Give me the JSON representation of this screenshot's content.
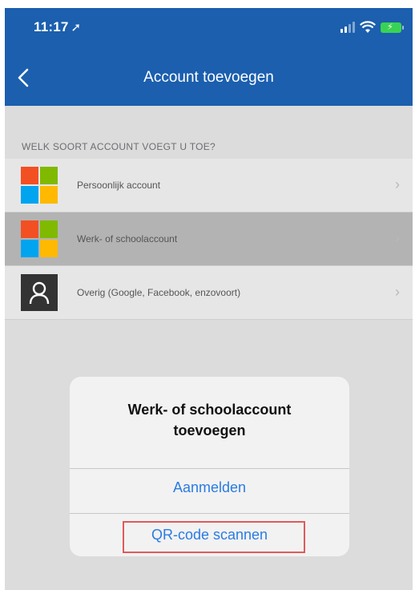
{
  "status_bar": {
    "time": "11:17",
    "location_icon": "location-arrow-icon",
    "signal_icon": "cellular-signal-icon",
    "wifi_icon": "wifi-icon",
    "battery_icon": "battery-charging-icon",
    "battery_color": "#39d353"
  },
  "nav": {
    "title": "Account toevoegen",
    "back_icon": "chevron-left-icon",
    "background": "#1b5fae"
  },
  "section_header": "WELK SOORT ACCOUNT VOEGT U TOE?",
  "accounts": [
    {
      "label": "Persoonlijk account",
      "icon": "microsoft-logo-icon",
      "selected": false
    },
    {
      "label": "Werk- of schoolaccount",
      "icon": "microsoft-logo-icon",
      "selected": true
    },
    {
      "label": "Overig (Google, Facebook, enzovoort)",
      "icon": "person-icon",
      "selected": false
    }
  ],
  "alert": {
    "title_line1": "Werk- of schoolaccount",
    "title_line2": "toevoegen",
    "sign_in": "Aanmelden",
    "scan_qr": "QR-code scannen",
    "highlight_color": "#e05a5a",
    "button_color": "#2a7be4"
  },
  "logo_colors": [
    "#f25022",
    "#7fba00",
    "#00a4ef",
    "#ffb900"
  ]
}
